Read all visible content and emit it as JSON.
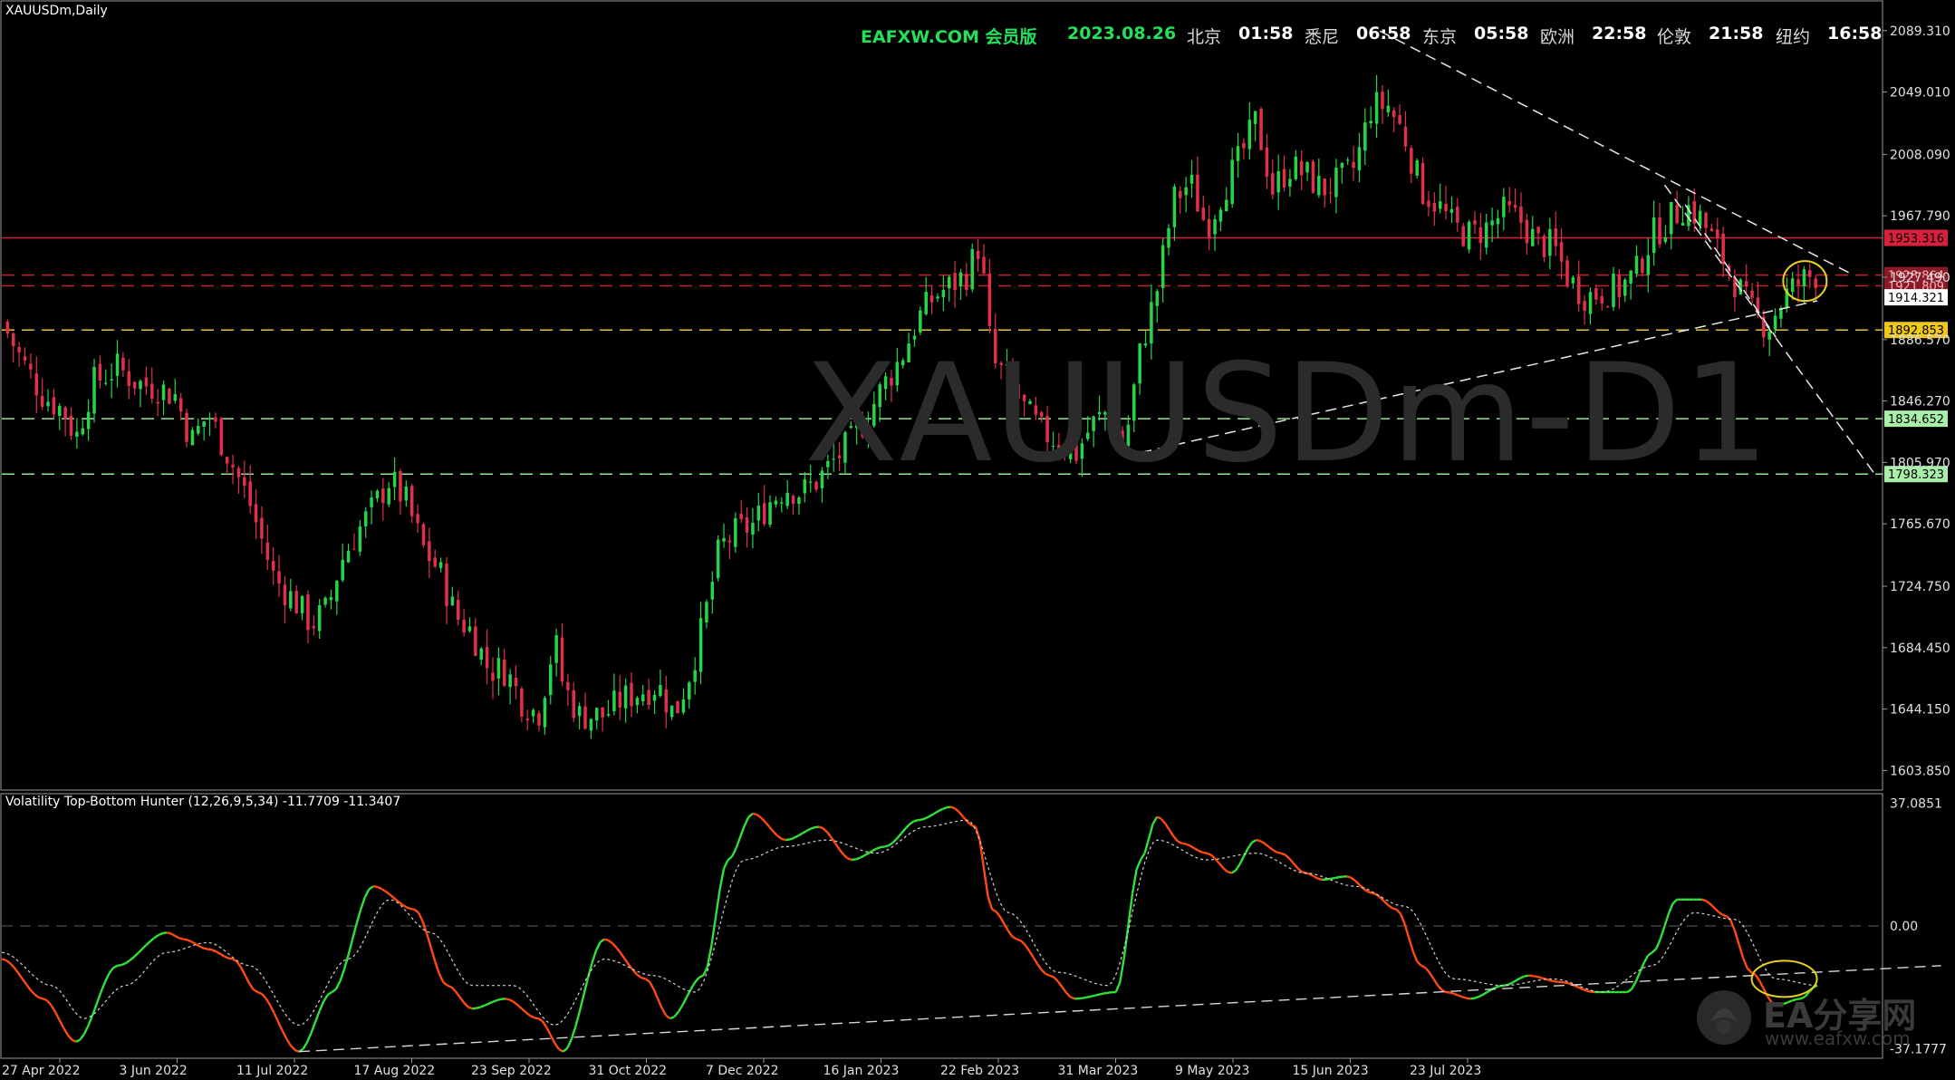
{
  "header": {
    "site": "EAFXW.COM 会员版",
    "date": "2023.08.26",
    "clocks": [
      {
        "city": "北京",
        "time": "01:58"
      },
      {
        "city": "悉尼",
        "time": "06:58"
      },
      {
        "city": "东京",
        "time": "05:58"
      },
      {
        "city": "欧洲",
        "time": "22:58"
      },
      {
        "city": "伦敦",
        "time": "21:58"
      },
      {
        "city": "纽约",
        "time": "16:58"
      }
    ]
  },
  "symbol_label": "XAUUSDm,Daily",
  "watermark": "XAUUSDm-D1",
  "indicator_label": "Volatility Top-Bottom Hunter (12,26,9,5,34) -11.7709 -11.3407",
  "logo": {
    "text": "EA分享网",
    "url": "www.eafxw.com"
  },
  "colors": {
    "bull": "#26d44a",
    "bear": "#e0304a",
    "fast_up": "#32e03a",
    "fast_down": "#ff4a10",
    "signal": "#d0d0d0"
  },
  "chart_data": [
    {
      "type": "candlestick",
      "title": "",
      "x_ticks": [
        "27 Apr 2022",
        "3 Jun 2022",
        "11 Jul 2022",
        "17 Aug 2022",
        "23 Sep 2022",
        "31 Oct 2022",
        "7 Dec 2022",
        "16 Jan 2023",
        "22 Feb 2023",
        "31 Mar 2023",
        "9 May 2023",
        "15 Jun 2023",
        "23 Jul 2023"
      ],
      "y_ticks": [
        "2089.310",
        "2049.010",
        "2008.090",
        "1967.790",
        "1927.490",
        "1886.570",
        "1846.270",
        "1805.970",
        "1765.670",
        "1724.750",
        "1684.450",
        "1644.150",
        "1603.850"
      ],
      "ylim": [
        1591,
        2107
      ],
      "close_path": [
        [
          0,
          1898
        ],
        [
          5,
          1872
        ],
        [
          10,
          1850
        ],
        [
          15,
          1840
        ],
        [
          18,
          1822
        ],
        [
          22,
          1858
        ],
        [
          28,
          1868
        ],
        [
          33,
          1858
        ],
        [
          38,
          1855
        ],
        [
          42,
          1850
        ],
        [
          46,
          1820
        ],
        [
          50,
          1838
        ],
        [
          55,
          1810
        ],
        [
          60,
          1780
        ],
        [
          66,
          1730
        ],
        [
          71,
          1715
        ],
        [
          75,
          1700
        ],
        [
          79,
          1710
        ],
        [
          82,
          1740
        ],
        [
          86,
          1760
        ],
        [
          90,
          1776
        ],
        [
          94,
          1795
        ],
        [
          98,
          1780
        ],
        [
          102,
          1750
        ],
        [
          106,
          1735
        ],
        [
          110,
          1705
        ],
        [
          114,
          1695
        ],
        [
          118,
          1670
        ],
        [
          122,
          1670
        ],
        [
          126,
          1650
        ],
        [
          130,
          1640
        ],
        [
          134,
          1690
        ],
        [
          136,
          1660
        ],
        [
          140,
          1640
        ],
        [
          146,
          1640
        ],
        [
          150,
          1650
        ],
        [
          154,
          1655
        ],
        [
          159,
          1660
        ],
        [
          163,
          1640
        ],
        [
          167,
          1670
        ],
        [
          170,
          1700
        ],
        [
          174,
          1750
        ],
        [
          178,
          1760
        ],
        [
          182,
          1765
        ],
        [
          186,
          1780
        ],
        [
          190,
          1790
        ],
        [
          194,
          1786
        ],
        [
          198,
          1795
        ],
        [
          202,
          1808
        ],
        [
          206,
          1820
        ],
        [
          210,
          1838
        ],
        [
          214,
          1858
        ],
        [
          218,
          1875
        ],
        [
          222,
          1900
        ],
        [
          226,
          1915
        ],
        [
          230,
          1922
        ],
        [
          234,
          1930
        ],
        [
          237,
          1950
        ],
        [
          240,
          1872
        ],
        [
          244,
          1860
        ],
        [
          248,
          1840
        ],
        [
          252,
          1826
        ],
        [
          256,
          1820
        ],
        [
          260,
          1810
        ],
        [
          264,
          1830
        ],
        [
          268,
          1840
        ],
        [
          272,
          1815
        ],
        [
          276,
          1880
        ],
        [
          280,
          1920
        ],
        [
          284,
          1978
        ],
        [
          288,
          1990
        ],
        [
          292,
          1960
        ],
        [
          296,
          1985
        ],
        [
          300,
          2005
        ],
        [
          304,
          2030
        ],
        [
          308,
          1985
        ],
        [
          312,
          2000
        ],
        [
          316,
          1995
        ],
        [
          320,
          1985
        ],
        [
          324,
          1990
        ],
        [
          328,
          2000
        ],
        [
          332,
          2040
        ],
        [
          336,
          2040
        ],
        [
          340,
          2020
        ],
        [
          344,
          1985
        ],
        [
          348,
          1975
        ],
        [
          352,
          1960
        ],
        [
          356,
          1955
        ],
        [
          360,
          1960
        ],
        [
          364,
          1970
        ],
        [
          368,
          1965
        ],
        [
          372,
          1950
        ],
        [
          376,
          1948
        ],
        [
          380,
          1925
        ],
        [
          384,
          1915
        ],
        [
          388,
          1918
        ],
        [
          392,
          1920
        ],
        [
          396,
          1930
        ],
        [
          400,
          1955
        ],
        [
          404,
          1965
        ],
        [
          408,
          1975
        ],
        [
          412,
          1965
        ],
        [
          416,
          1945
        ],
        [
          420,
          1925
        ],
        [
          424,
          1905
        ],
        [
          428,
          1895
        ],
        [
          432,
          1915
        ],
        [
          436,
          1925
        ],
        [
          440,
          1930
        ]
      ],
      "horizontal_levels": [
        {
          "value": 1953.316,
          "label": "1953.316",
          "style": "solid",
          "color": "#d8203c"
        },
        {
          "value": 1928.864,
          "label": "1928.864",
          "style": "dashed",
          "color": "#c02030"
        },
        {
          "value": 1921.809,
          "label": "1921.809",
          "style": "dashed",
          "color": "#c02030"
        },
        {
          "value": 1914.321,
          "label": "1914.321",
          "style": "none",
          "color": "#ffffff"
        },
        {
          "value": 1892.853,
          "label": "1892.853",
          "style": "dashed",
          "color": "#e8c020"
        },
        {
          "value": 1834.652,
          "label": "1834.652",
          "style": "dashed",
          "color": "#90e890"
        },
        {
          "value": 1798.323,
          "label": "1798.323",
          "style": "dashed",
          "color": "#90e890"
        }
      ]
    },
    {
      "type": "line",
      "title": "",
      "y_ticks": [
        "37.0851",
        "0.00",
        "-37.1777"
      ],
      "ylim": [
        -40,
        40
      ],
      "series": [
        {
          "values": [
            [
              0,
              -10
            ],
            [
              10,
              -22
            ],
            [
              18,
              -35
            ],
            [
              28,
              -12
            ],
            [
              40,
              -2
            ],
            [
              44,
              -4
            ],
            [
              50,
              -7
            ],
            [
              56,
              -10
            ],
            [
              62,
              -20
            ],
            [
              72,
              -38
            ],
            [
              80,
              -20
            ],
            [
              90,
              12
            ],
            [
              100,
              5
            ],
            [
              108,
              -18
            ],
            [
              114,
              -25
            ],
            [
              122,
              -22
            ],
            [
              130,
              -28
            ],
            [
              136,
              -38
            ],
            [
              146,
              -4
            ],
            [
              156,
              -16
            ],
            [
              162,
              -28
            ],
            [
              170,
              -15
            ],
            [
              176,
              20
            ],
            [
              182,
              34
            ],
            [
              190,
              26
            ],
            [
              198,
              30
            ],
            [
              206,
              20
            ],
            [
              214,
              24
            ],
            [
              222,
              32
            ],
            [
              230,
              36
            ],
            [
              236,
              30
            ],
            [
              240,
              5
            ],
            [
              246,
              -4
            ],
            [
              254,
              -15
            ],
            [
              260,
              -22
            ],
            [
              270,
              -20
            ],
            [
              276,
              20
            ],
            [
              280,
              33
            ],
            [
              286,
              25
            ],
            [
              292,
              22
            ],
            [
              298,
              16
            ],
            [
              304,
              26
            ],
            [
              310,
              22
            ],
            [
              316,
              16
            ],
            [
              320,
              14
            ],
            [
              326,
              15
            ],
            [
              332,
              10
            ],
            [
              338,
              5
            ],
            [
              344,
              -12
            ],
            [
              350,
              -20
            ],
            [
              356,
              -22
            ],
            [
              364,
              -18
            ],
            [
              370,
              -15
            ],
            [
              378,
              -17
            ],
            [
              386,
              -20
            ],
            [
              394,
              -20
            ],
            [
              400,
              -8
            ],
            [
              406,
              8
            ],
            [
              412,
              8
            ],
            [
              418,
              3
            ],
            [
              424,
              -14
            ],
            [
              430,
              -24
            ],
            [
              436,
              -22
            ],
            [
              440,
              -18
            ]
          ]
        },
        {
          "values": [
            [
              0,
              -8
            ],
            [
              12,
              -18
            ],
            [
              20,
              -28
            ],
            [
              30,
              -18
            ],
            [
              40,
              -8
            ],
            [
              50,
              -5
            ],
            [
              60,
              -12
            ],
            [
              72,
              -30
            ],
            [
              84,
              -10
            ],
            [
              94,
              8
            ],
            [
              104,
              -2
            ],
            [
              114,
              -18
            ],
            [
              124,
              -18
            ],
            [
              134,
              -30
            ],
            [
              146,
              -10
            ],
            [
              158,
              -15
            ],
            [
              168,
              -20
            ],
            [
              180,
              20
            ],
            [
              190,
              24
            ],
            [
              200,
              26
            ],
            [
              212,
              22
            ],
            [
              224,
              30
            ],
            [
              234,
              32
            ],
            [
              244,
              4
            ],
            [
              256,
              -14
            ],
            [
              268,
              -18
            ],
            [
              280,
              26
            ],
            [
              292,
              20
            ],
            [
              304,
              22
            ],
            [
              316,
              16
            ],
            [
              328,
              12
            ],
            [
              340,
              6
            ],
            [
              352,
              -16
            ],
            [
              364,
              -18
            ],
            [
              376,
              -16
            ],
            [
              388,
              -20
            ],
            [
              400,
              -12
            ],
            [
              410,
              4
            ],
            [
              420,
              2
            ],
            [
              430,
              -16
            ],
            [
              440,
              -18
            ]
          ]
        }
      ]
    }
  ]
}
